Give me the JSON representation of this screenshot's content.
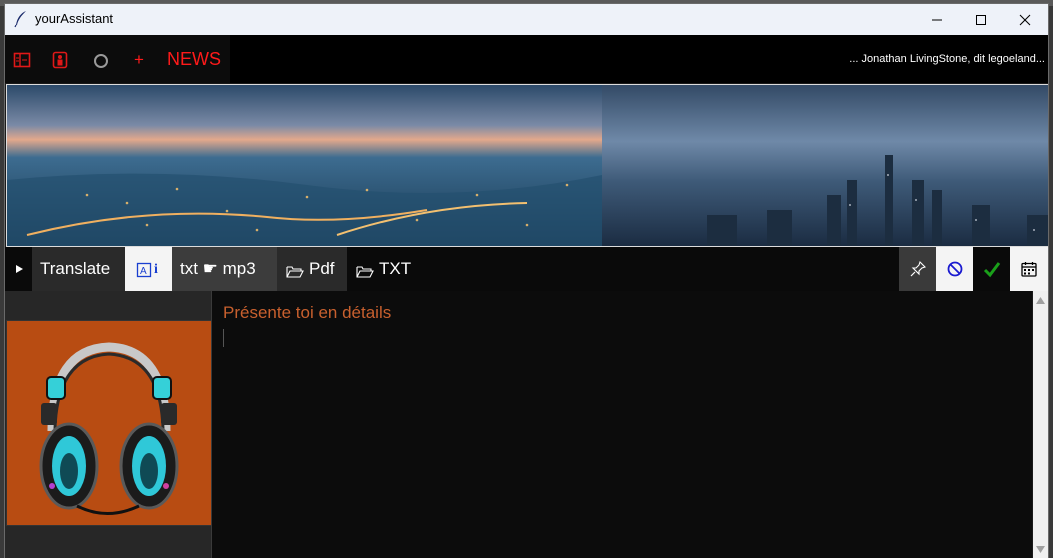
{
  "window": {
    "title": "yourAssistant",
    "controls": {
      "minimize": "minimize-icon",
      "maximize": "maximize-icon",
      "close": "close-icon"
    }
  },
  "toolbar": {
    "icons": [
      "layout-icon",
      "person-icon",
      "circle-icon",
      "plus-icon"
    ],
    "plus_label": "+",
    "news_label": "NEWS",
    "ticker_text": "... Jonathan LivingStone, dit legoeland...",
    "news_color": "#ff1a1a"
  },
  "tabs": {
    "expand_icon": "play-icon",
    "translate_label": "Translate",
    "ai_icon": "ai-info-icon",
    "txt_mp3_label": "txt ☛ mp3",
    "pdf_label": "Pdf",
    "txt_label": "TXT",
    "right_icons": [
      "pin-icon",
      "cancel-icon",
      "check-icon",
      "calendar-icon"
    ]
  },
  "editor": {
    "prompt_text": "Présente toi en détails",
    "prompt_color": "#c8602e"
  },
  "sidebar": {
    "art": "headphones-image",
    "art_bg": "#b84c12"
  }
}
